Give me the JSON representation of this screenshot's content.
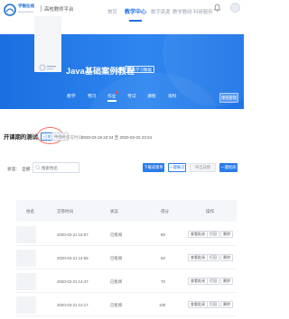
{
  "topnav": {
    "brand": "学银在线",
    "brand_sub": "xueyinonline",
    "platform": "高校教师平台",
    "items": [
      {
        "label": "首页",
        "active": false
      },
      {
        "label": "教学中心",
        "active": true
      },
      {
        "label": "数字资源",
        "active": false
      },
      {
        "label": "教学教研",
        "active": false
      },
      {
        "label": "科研服务",
        "active": false
      }
    ]
  },
  "banner": {
    "title": "Java基础案例教程",
    "badge": "查看学习数据",
    "tabs": [
      {
        "label": "教学",
        "has_dot": false,
        "active": false
      },
      {
        "label": "预习",
        "has_dot": false,
        "active": false
      },
      {
        "label": "作业",
        "has_dot": true,
        "active": true
      },
      {
        "label": "考试",
        "has_dot": false,
        "active": false
      },
      {
        "label": "课程",
        "has_dot": false,
        "active": false
      },
      {
        "label": "资料",
        "has_dot": false,
        "active": false
      }
    ],
    "manage_button": "课程管理"
  },
  "assignment": {
    "title": "开课期的测试",
    "status_primary": "已发布(共)",
    "status_secondary": "待批阅",
    "time_label": "作答时间:",
    "time_value": "2020-03-19 22:24 至 2020-03-22 23:24"
  },
  "filter": {
    "label": "状态:",
    "value": "全部",
    "search_placeholder": "搜索姓名",
    "buttons": {
      "download": "下载成绩单",
      "remind": "一键催交",
      "export": "导出成绩",
      "grade": "一键批阅"
    }
  },
  "table": {
    "headers": [
      "姓名",
      "交卷时间",
      "状态",
      "得分",
      "操作"
    ],
    "rows": [
      {
        "time": "2020-03-21 15:07",
        "status": "已批阅",
        "score": "80",
        "actions": [
          "查看批阅",
          "打回",
          "删除"
        ]
      },
      {
        "time": "2020-03-21 14:55",
        "status": "已批阅",
        "score": "60",
        "actions": [
          "查看批阅",
          "打回",
          "删除"
        ]
      },
      {
        "time": "2020-03-21 14:47",
        "status": "已批阅",
        "score": "70",
        "actions": [
          "查看批阅",
          "打回",
          "删除"
        ]
      },
      {
        "time": "2020-03-21 14:17",
        "status": "已批阅",
        "score": "100",
        "actions": [
          "查看批阅",
          "打回",
          "删除"
        ]
      }
    ]
  },
  "colors": {
    "primary": "#1e6fe6",
    "banner": "#2a80ee",
    "badge_red": "#ff4d3a",
    "annotation": "#ff6b5a"
  }
}
